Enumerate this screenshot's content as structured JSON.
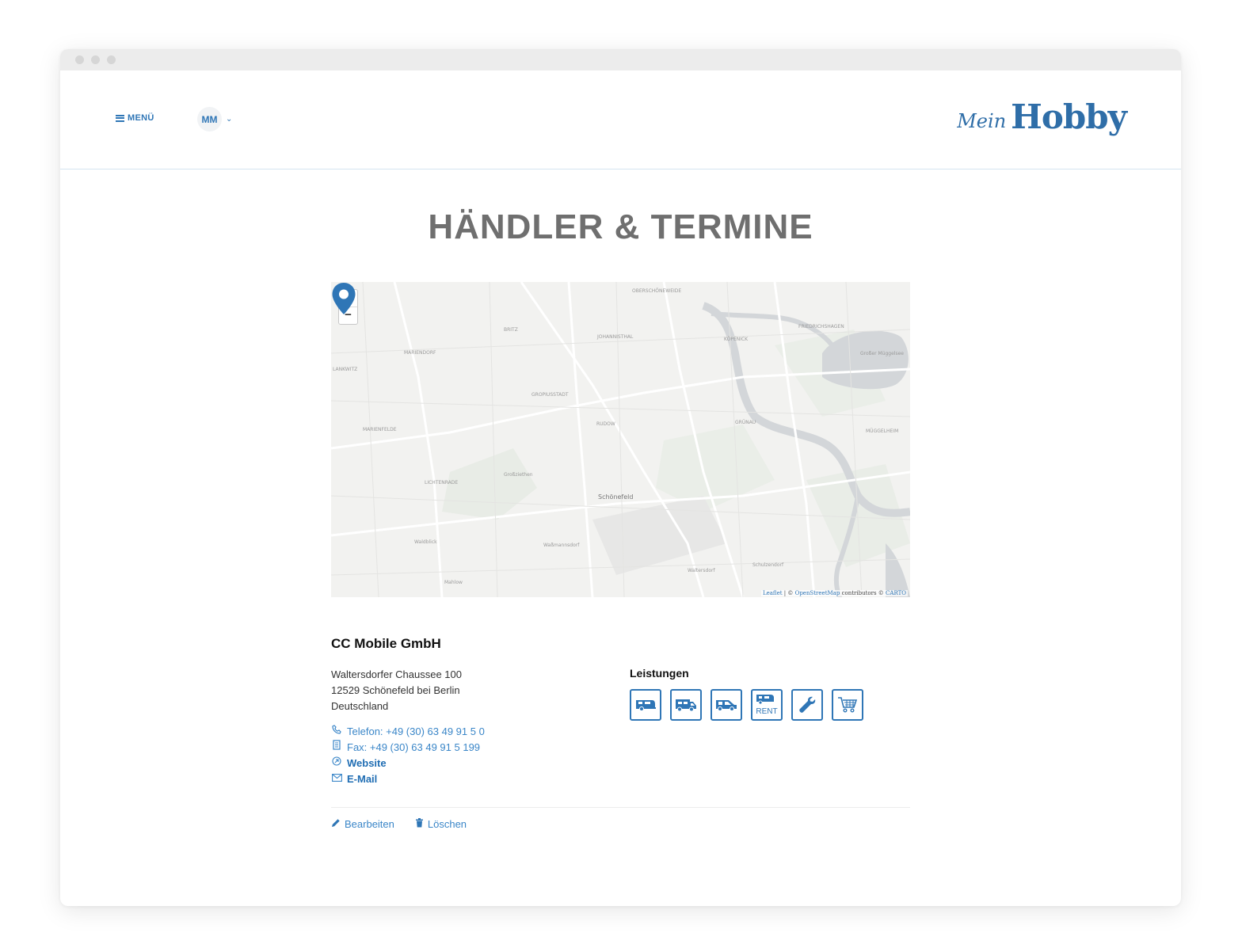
{
  "header": {
    "menu_label": "MENÜ",
    "user_initials": "MM",
    "logo_prefix": "Mein",
    "logo_brand": "Hobby"
  },
  "page": {
    "title": "HÄNDLER & TERMINE"
  },
  "map": {
    "zoom_in": "+",
    "zoom_out": "−",
    "attribution_leaflet": "Leaflet",
    "attribution_osm": "OpenStreetMap",
    "attribution_text": "contributors ©",
    "attribution_carto": "CARTO",
    "labels": {
      "oberschoeneweide": "OBERSCHÖNEWEIDE",
      "britz": "BRITZ",
      "johannisthal": "JOHANNISTHAL",
      "koepenick": "KÖPENICK",
      "friedrichshagen": "FRIEDRICHSHAGEN",
      "mariendorf": "MARIENDORF",
      "lankwitz": "LANKWITZ",
      "mueggelsee": "Großer Müggelsee",
      "gropiusstadt": "GROPIUSSTADT",
      "marienfelde": "MARIENFELDE",
      "gruenau": "GRÜNAU",
      "mueggelheim": "MÜGGELHEIM",
      "lichtenrade": "LICHTENRADE",
      "grossziethen": "Großziethen",
      "schoenefeld": "Schönefeld",
      "waldblick": "Waldblick",
      "wassmannsdorf": "Waßmannsdorf",
      "waltersdorf": "Waltersdorf",
      "schulzendorf": "Schulzendorf",
      "mahlow": "Mahlow",
      "rudow": "RUDOW"
    }
  },
  "dealer": {
    "name": "CC Mobile GmbH",
    "street": "Waltersdorfer Chaussee 100",
    "city": "12529 Schönefeld bei Berlin",
    "country": "Deutschland",
    "phone": "Telefon: +49 (30) 63 49 91 5 0",
    "fax": "Fax: +49 (30) 63 49 91 5 199",
    "website": "Website",
    "email": "E-Mail"
  },
  "services": {
    "title": "Leistungen",
    "items": [
      {
        "icon": "caravan-icon"
      },
      {
        "icon": "motorhome-icon"
      },
      {
        "icon": "van-icon"
      },
      {
        "icon": "rent-icon",
        "label": "RENT"
      },
      {
        "icon": "wrench-icon"
      },
      {
        "icon": "shopping-cart-icon"
      }
    ]
  },
  "actions": {
    "edit": "Bearbeiten",
    "delete": "Löschen"
  },
  "colors": {
    "accent": "#2f76b6",
    "link": "#3a86c8",
    "title_gray": "#6f6f6f",
    "water": "#d3d6d9"
  }
}
